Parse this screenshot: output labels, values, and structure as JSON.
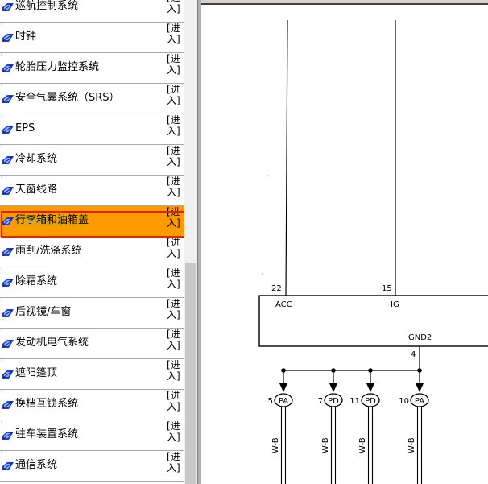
{
  "sidebar": {
    "enter_link_label": "[进入]",
    "items": [
      {
        "label": "巡航控制系统"
      },
      {
        "label": "时钟"
      },
      {
        "label": "轮胎压力监控系统"
      },
      {
        "label": "安全气囊系统（SRS）"
      },
      {
        "label": "EPS"
      },
      {
        "label": "冷却系统"
      },
      {
        "label": "天窗线路"
      },
      {
        "label": "行李箱和油箱盖",
        "selected": true
      },
      {
        "label": "雨刮/洗涤系统"
      },
      {
        "label": "除霜系统"
      },
      {
        "label": "后视镜/车窗"
      },
      {
        "label": "发动机电气系统"
      },
      {
        "label": "遮阳篷顶"
      },
      {
        "label": "换档互锁系统"
      },
      {
        "label": "驻车装置系统"
      },
      {
        "label": "通信系统"
      }
    ]
  },
  "diagram": {
    "pins": {
      "acc_pin": "22",
      "ig_pin": "15",
      "gnd_pin": "4"
    },
    "terminals": {
      "acc": "ACC",
      "ig": "IG",
      "gnd": "GND2"
    },
    "connectors": [
      {
        "num": "5",
        "code": "PA",
        "wire": "W-B"
      },
      {
        "num": "7",
        "code": "PD",
        "wire": "W-B"
      },
      {
        "num": "11",
        "code": "PD",
        "wire": "W-B"
      },
      {
        "num": "10",
        "code": "PA",
        "wire": "W-B"
      }
    ]
  },
  "colors": {
    "selected_row": "#ff9a00",
    "highlight_border": "#e02020",
    "icon_blue": "#1f3fd0"
  }
}
